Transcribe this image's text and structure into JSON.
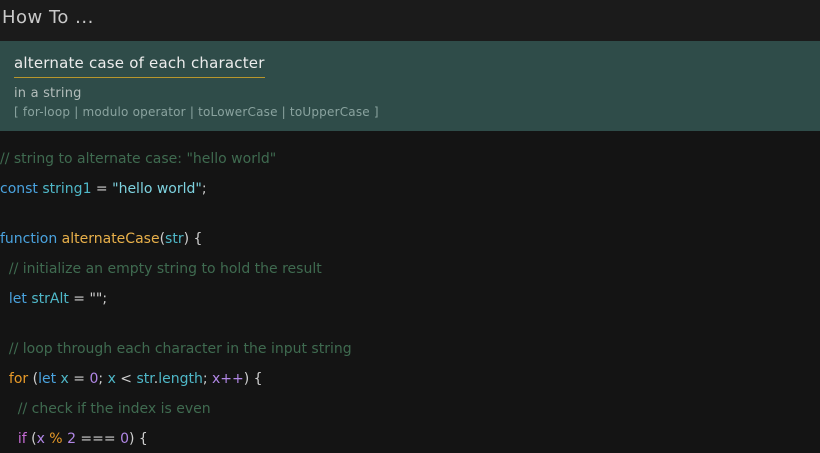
{
  "header": {
    "title": "How To ..."
  },
  "topic": {
    "title": "alternate case of each character",
    "subtitle": "in a string",
    "tags": "[ for-loop | modulo operator | toLowerCase | toUpperCase ]"
  },
  "code": {
    "l1": "// string to alternate case: \"hello world\"",
    "l2_kw": "const",
    "l2_var": "string1",
    "l2_eq": " = ",
    "l2_str": "\"hello world\"",
    "l2_end": ";",
    "l3_kw": "function",
    "l3_name": "alternateCase",
    "l3_open": "(",
    "l3_param": "str",
    "l3_close": ") {",
    "l4": "  // initialize an empty string to hold the result",
    "l5_indent": "  ",
    "l5_kw": "let",
    "l5_var": "strAlt",
    "l5_rest": " = \"\";",
    "l6": "  // loop through each character in the input string",
    "l7_indent": "  ",
    "l7_for": "for",
    "l7_open": " (",
    "l7_let": "let",
    "l7_x1": " x",
    "l7_eq": " = ",
    "l7_zero": "0",
    "l7_semi1": "; ",
    "l7_x2": "x",
    "l7_lt": " < ",
    "l7_str": "str",
    "l7_dot": ".",
    "l7_len": "length",
    "l7_semi2": "; ",
    "l7_inc": "x++",
    "l7_end": ") {",
    "l8": "    // check if the index is even",
    "l9_indent": "    ",
    "l9_if": "if",
    "l9_open": " (",
    "l9_x": "x",
    "l9_mod": " % ",
    "l9_two": "2",
    "l9_eq": " === ",
    "l9_zero": "0",
    "l9_end": ") {"
  }
}
